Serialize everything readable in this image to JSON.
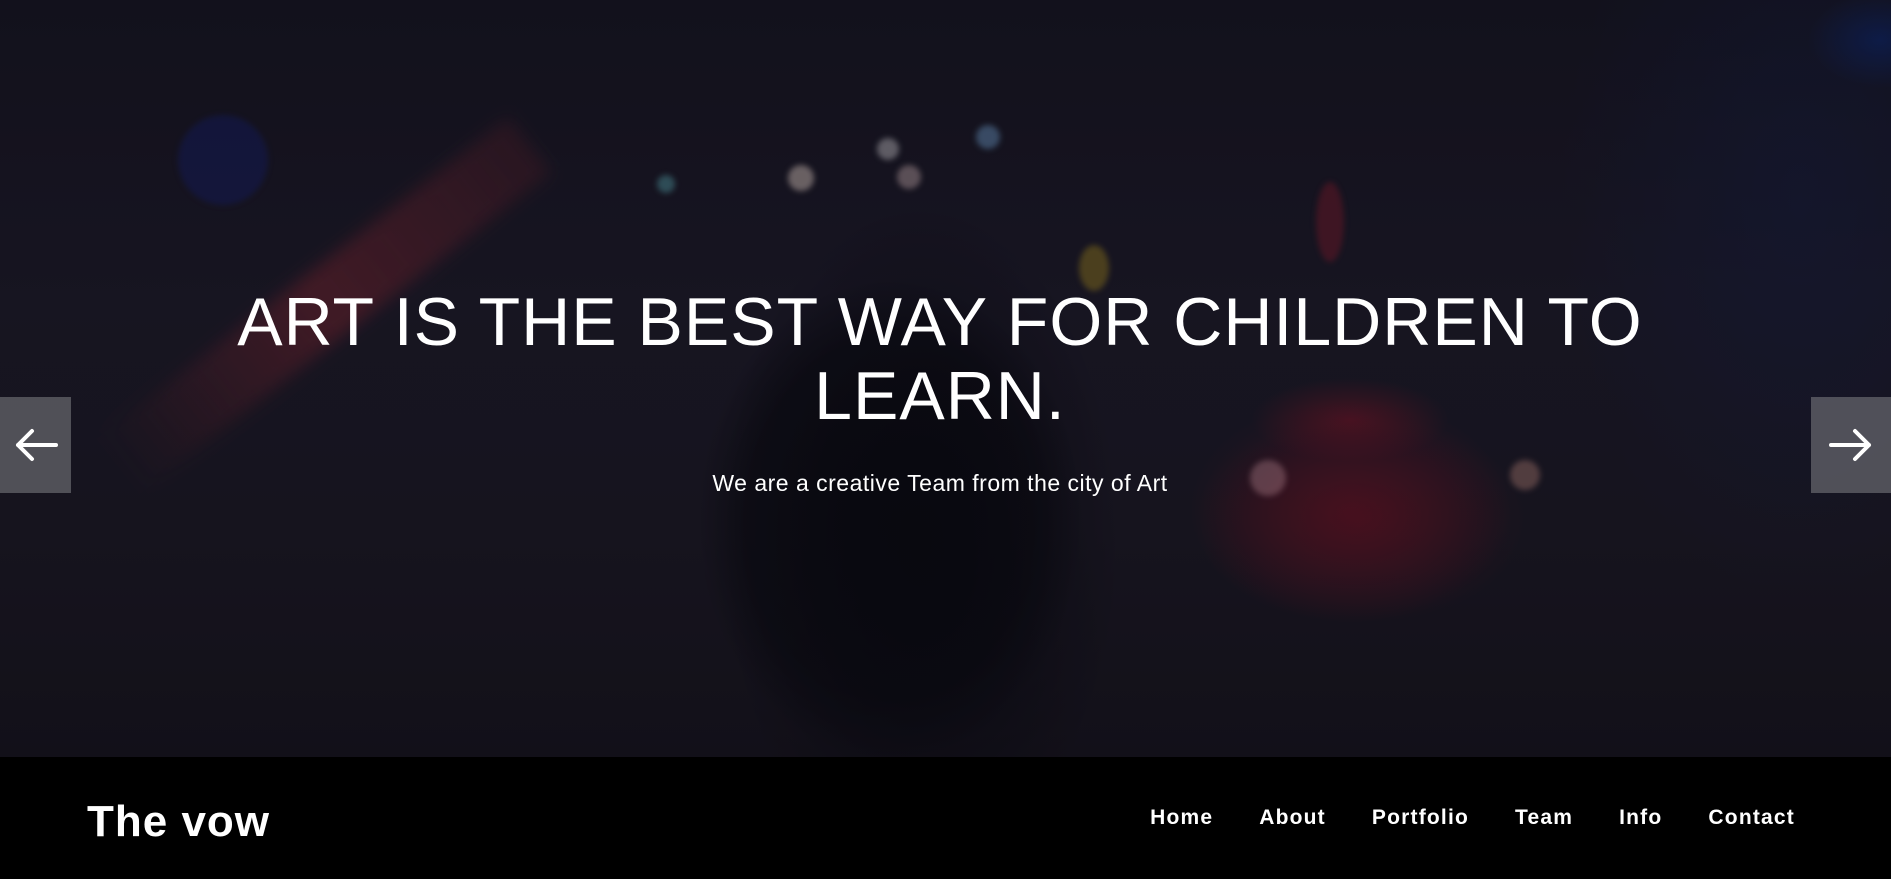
{
  "hero": {
    "title": "ART IS THE BEST WAY FOR CHILDREN TO LEARN.",
    "subtitle": "We are a creative Team from the city of Art",
    "prev_icon": "arrow-left-icon",
    "next_icon": "arrow-right-icon"
  },
  "navbar": {
    "brand": "The vow",
    "items": [
      {
        "label": "Home"
      },
      {
        "label": "About"
      },
      {
        "label": "Portfolio"
      },
      {
        "label": "Team"
      },
      {
        "label": "Info"
      },
      {
        "label": "Contact"
      }
    ]
  },
  "colors": {
    "text": "#ffffff",
    "navbar_bg": "#000000",
    "arrow_bg": "#78787d"
  }
}
